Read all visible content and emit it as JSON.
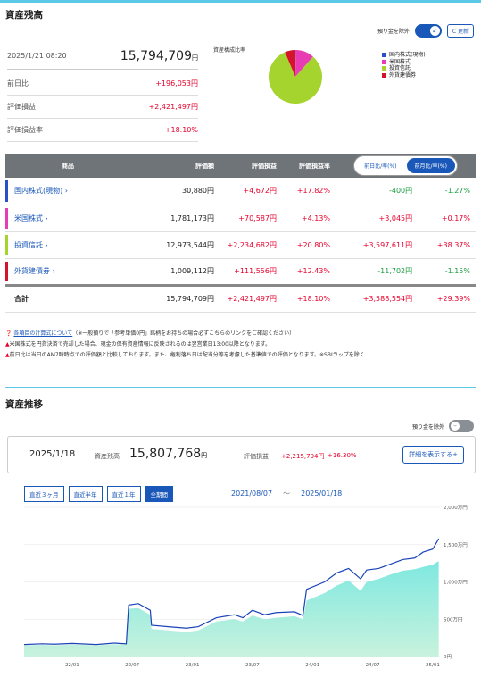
{
  "asset_balance": {
    "title": "資産残高",
    "exclude_deposit_label": "預り金を除外",
    "refresh_label": "C 更新",
    "datetime": "2025/1/21 08:20",
    "total": "15,794,709",
    "yen": "円",
    "rows": [
      {
        "label": "前日比",
        "value": "+196,053円"
      },
      {
        "label": "評価損益",
        "value": "+2,421,497円"
      },
      {
        "label": "評価損益率",
        "value": "+18.10%"
      }
    ]
  },
  "composition": {
    "title": "資産構成比率",
    "legend": [
      {
        "label": "国内株式(現物)",
        "color": "#2850c8"
      },
      {
        "label": "米国株式",
        "color": "#e83cb4"
      },
      {
        "label": "投資信託",
        "color": "#a6d42e"
      },
      {
        "label": "外貨建債券",
        "color": "#d4142a"
      }
    ]
  },
  "holdings": {
    "headers": [
      "商品",
      "評価額",
      "評価損益",
      "評価損益率"
    ],
    "toggle": [
      "前日比/率(%)",
      "前月比/率(%)"
    ],
    "rows": [
      {
        "name": "国内株式(現物) ›",
        "color": "#2850c8",
        "value": "30,880円",
        "pl": "+4,672円",
        "rate": "+17.82%",
        "diff": "-400円",
        "diff_rate": "-1.27%",
        "diff_sign": "neg"
      },
      {
        "name": "米国株式 ›",
        "color": "#e83cb4",
        "value": "1,781,173円",
        "pl": "+70,587円",
        "rate": "+4.13%",
        "diff": "+3,045円",
        "diff_rate": "+0.17%",
        "diff_sign": "pos"
      },
      {
        "name": "投資信託 ›",
        "color": "#a6d42e",
        "value": "12,973,544円",
        "pl": "+2,234,682円",
        "rate": "+20.80%",
        "diff": "+3,597,611円",
        "diff_rate": "+38.37%",
        "diff_sign": "pos"
      },
      {
        "name": "外貨建債券 ›",
        "color": "#d4142a",
        "value": "1,009,112円",
        "pl": "+111,556円",
        "rate": "+12.43%",
        "diff": "-11,702円",
        "diff_rate": "-1.15%",
        "diff_sign": "neg"
      }
    ],
    "total": {
      "name": "合計",
      "value": "15,794,709円",
      "pl": "+2,421,497円",
      "rate": "+18.10%",
      "diff": "+3,588,554円",
      "diff_rate": "+29.39%"
    }
  },
  "notes": {
    "link": "各項目の計算式について",
    "link_suffix": "（※一般預りで「参考単価0円」銘柄をお持ちの場合必ずこちらのリンクをご確認ください）",
    "warn1": "米国株式を円貨決済で売却した場合、現金の保有資産情報に反映されるのは翌営業日13:00以降となります。",
    "warn2": "前日比は当日のAM7時時点での評価額と比較しております。また、権利落ち日は配当分等を考慮した基準値での評価となります。※SBIラップを除く"
  },
  "trend": {
    "title": "資産推移",
    "exclude_deposit_label": "預り金を除外",
    "date": "2025/1/18",
    "total_label": "資産残高",
    "total": "15,807,768",
    "yen": "円",
    "pl_label": "評価損益",
    "pl": "+2,215,794円",
    "pl_rate": "+16.30%",
    "detail_button": "詳細を表示する+",
    "periods": [
      "直近３ヶ月",
      "直近半年",
      "直近１年",
      "全期間"
    ],
    "active_period": 3,
    "range_from": "2021/08/07",
    "range_sep": "〜",
    "range_to": "2025/01/18"
  },
  "chart_data": [
    {
      "type": "pie",
      "title": "資産構成比率",
      "categories": [
        "国内株式(現物)",
        "米国株式",
        "投資信託",
        "外貨建債券"
      ],
      "values": [
        30880,
        1781173,
        12973544,
        1009112
      ],
      "colors": [
        "#2850c8",
        "#e83cb4",
        "#a6d42e",
        "#d4142a"
      ]
    },
    {
      "type": "area",
      "title": "資産推移",
      "x_ticks": [
        "22/01",
        "22/07",
        "23/01",
        "23/07",
        "24/01",
        "24/07",
        "25/01"
      ],
      "y_ticks": [
        "0円",
        "500万円",
        "1,000万円",
        "1,500万円",
        "2,000万円"
      ],
      "ylim": [
        0,
        2000
      ],
      "y_unit": "万円",
      "x": [
        2021.6,
        2021.75,
        2021.85,
        2022.0,
        2022.2,
        2022.35,
        2022.45,
        2022.47,
        2022.55,
        2022.65,
        2022.66,
        2022.8,
        2022.95,
        2023.05,
        2023.2,
        2023.35,
        2023.42,
        2023.5,
        2023.6,
        2023.7,
        2023.85,
        2023.92,
        2023.95,
        2024.1,
        2024.2,
        2024.3,
        2024.4,
        2024.45,
        2024.55,
        2024.65,
        2024.75,
        2024.85,
        2024.92,
        2025.0,
        2025.05
      ],
      "series": [
        {
          "name": "資産残高",
          "values": [
            160,
            170,
            165,
            175,
            160,
            180,
            170,
            690,
            710,
            620,
            420,
            400,
            380,
            400,
            520,
            560,
            520,
            620,
            560,
            590,
            600,
            550,
            900,
            1000,
            1120,
            1180,
            1040,
            1160,
            1180,
            1240,
            1300,
            1320,
            1400,
            1440,
            1580
          ]
        },
        {
          "name": "評価額",
          "values": [
            150,
            155,
            150,
            160,
            150,
            165,
            160,
            640,
            650,
            560,
            370,
            350,
            330,
            350,
            470,
            500,
            470,
            550,
            500,
            520,
            540,
            500,
            750,
            850,
            950,
            1020,
            880,
            1000,
            1040,
            1100,
            1150,
            1170,
            1200,
            1230,
            1280
          ]
        }
      ]
    }
  ]
}
